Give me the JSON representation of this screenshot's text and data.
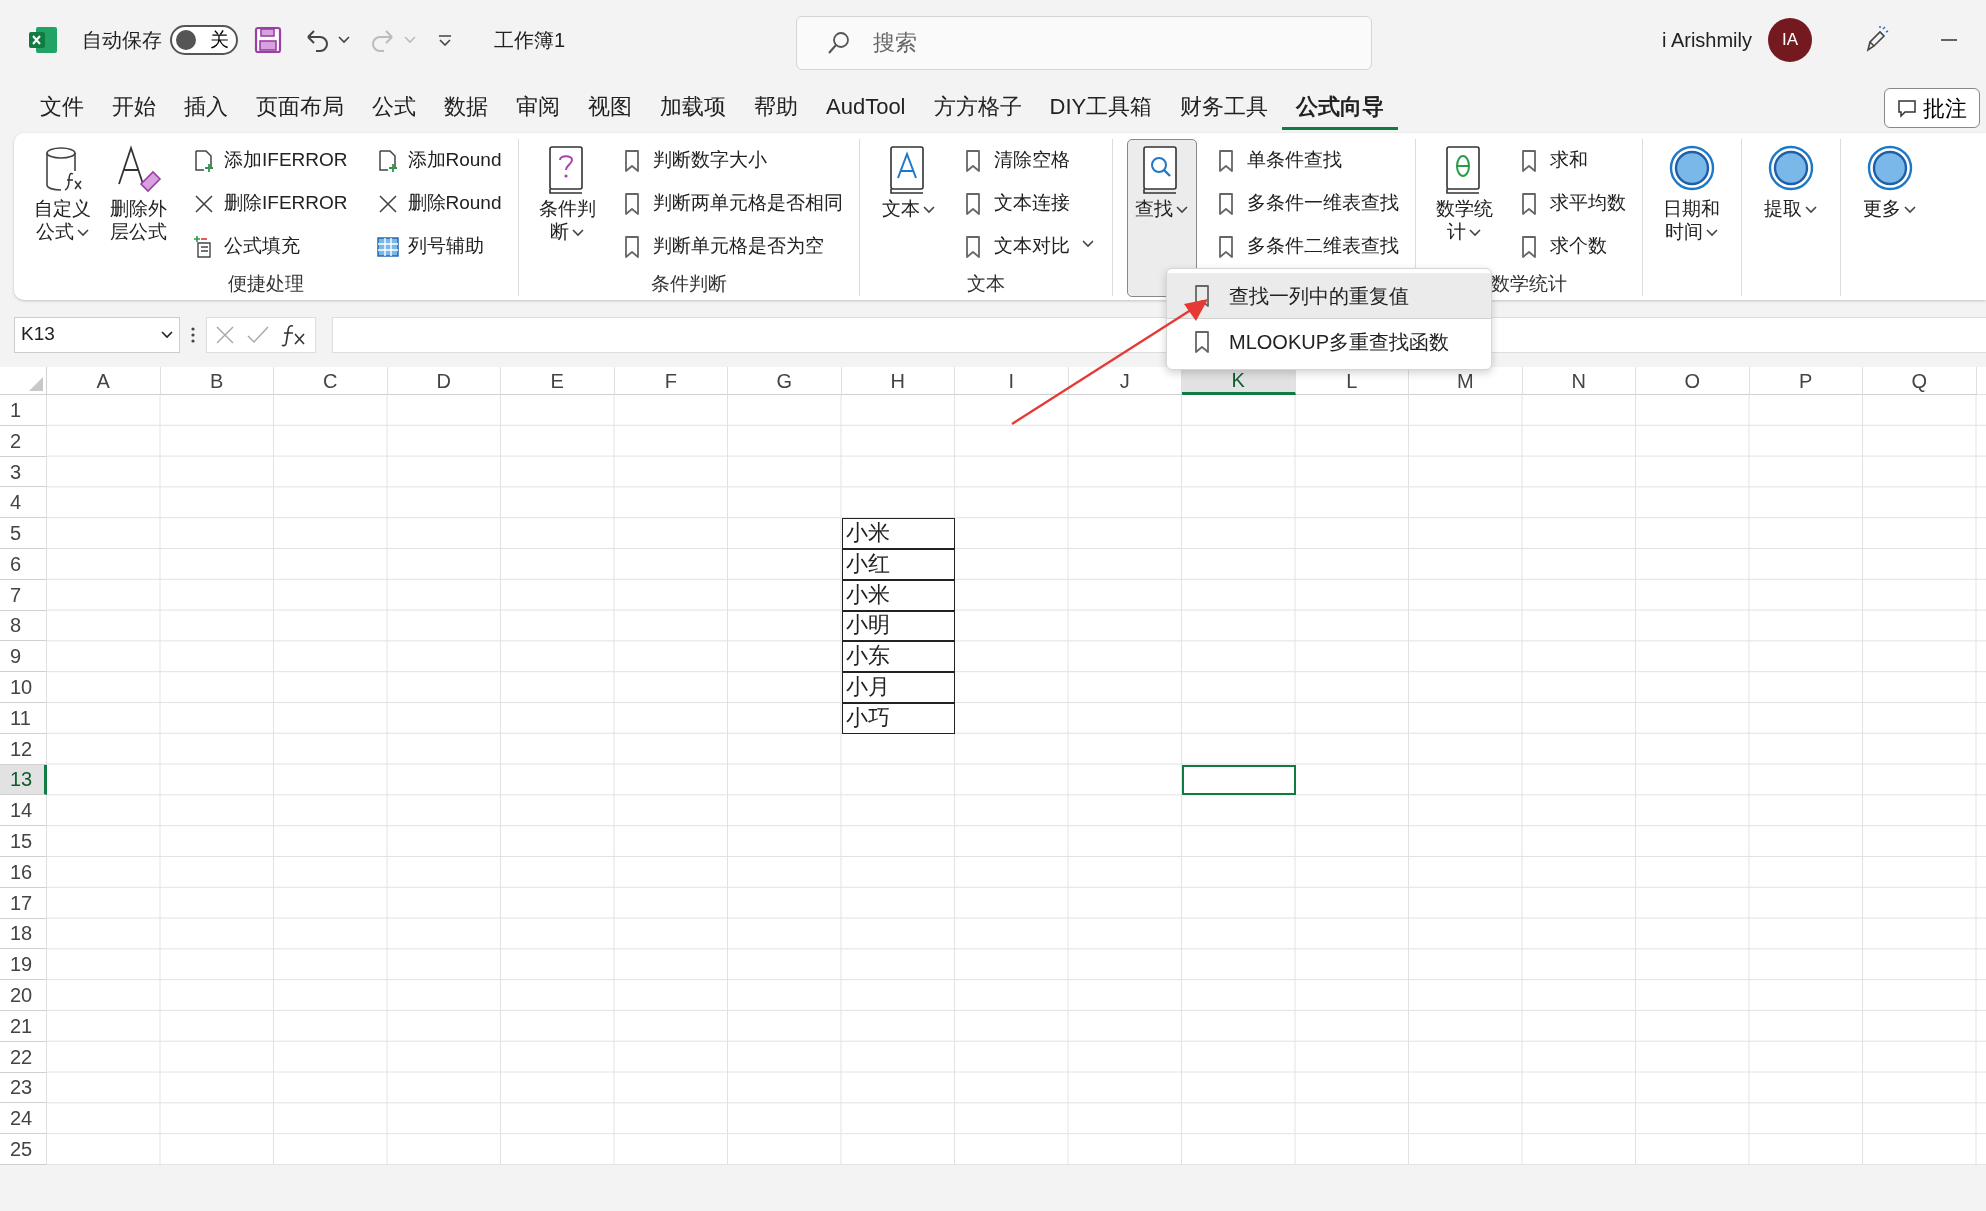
{
  "title_bar": {
    "autosave": {
      "label": "自动保存",
      "state_text": "关",
      "on": false
    },
    "workbook": "工作簿1",
    "search": {
      "placeholder": "搜索"
    },
    "user": "i Arishmily",
    "avatar": "IA"
  },
  "menu_tabs": [
    {
      "label": "文件",
      "selected": false
    },
    {
      "label": "开始",
      "selected": false
    },
    {
      "label": "插入",
      "selected": false
    },
    {
      "label": "页面布局",
      "selected": false
    },
    {
      "label": "公式",
      "selected": false
    },
    {
      "label": "数据",
      "selected": false
    },
    {
      "label": "审阅",
      "selected": false
    },
    {
      "label": "视图",
      "selected": false
    },
    {
      "label": "加载项",
      "selected": false
    },
    {
      "label": "帮助",
      "selected": false
    },
    {
      "label": "AudTool",
      "selected": false
    },
    {
      "label": "方方格子",
      "selected": false
    },
    {
      "label": "DIY工具箱",
      "selected": false
    },
    {
      "label": "财务工具",
      "selected": false
    },
    {
      "label": "公式向导",
      "selected": true
    }
  ],
  "comment_button": "批注",
  "ribbon_groups": [
    {
      "label": "便捷处理",
      "large": [
        {
          "label": "自定义公式",
          "menu": true,
          "expanded": false
        },
        {
          "label": "删除外层公式",
          "menu": false,
          "expanded": false
        }
      ],
      "items": [
        "添加IFERROR",
        "删除IFERROR",
        "公式填充",
        "添加Round",
        "删除Round",
        "列号辅助"
      ]
    },
    {
      "label": "条件判断",
      "large": [
        {
          "label": "条件判断",
          "menu": true,
          "expanded": false
        }
      ],
      "items": [
        "判断数字大小",
        "判断两单元格是否相同",
        "判断单元格是否为空"
      ]
    },
    {
      "label": "文本",
      "overflow_menu": true,
      "large": [
        {
          "label": "文本",
          "menu": true,
          "expanded": false
        }
      ],
      "items": [
        "清除空格",
        "文本连接",
        "文本对比"
      ]
    },
    {
      "large": [
        {
          "label": "查找",
          "menu": true,
          "expanded": true
        }
      ],
      "items": [
        "单条件查找",
        "多条件一维表查找",
        "多条件二维表查找"
      ]
    },
    {
      "label": "数学统计",
      "large": [
        {
          "label": "数学统计",
          "menu": true,
          "expanded": false
        }
      ],
      "items": [
        "求和",
        "求平均数",
        "求个数"
      ]
    },
    {
      "large": [
        {
          "label": "日期和时间",
          "menu": true,
          "expanded": false
        }
      ]
    },
    {
      "large": [
        {
          "label": "提取",
          "menu": true,
          "expanded": false
        }
      ]
    },
    {
      "large": [
        {
          "label": "更多",
          "menu": true,
          "expanded": false
        }
      ]
    }
  ],
  "dropdown": {
    "items": [
      {
        "label": "查找一列中的重复值",
        "selected": true
      },
      {
        "label": "MLOOKUP多重查找函数",
        "selected": false
      }
    ]
  },
  "formula_bar": {
    "name_box": "K13"
  },
  "sheet": {
    "columns": [
      {
        "label": "A",
        "highlighted": false
      },
      {
        "label": "B",
        "highlighted": false
      },
      {
        "label": "C",
        "highlighted": false
      },
      {
        "label": "D",
        "highlighted": false
      },
      {
        "label": "E",
        "highlighted": false
      },
      {
        "label": "F",
        "highlighted": false
      },
      {
        "label": "G",
        "highlighted": false
      },
      {
        "label": "H",
        "highlighted": false
      },
      {
        "label": "I",
        "highlighted": false
      },
      {
        "label": "J",
        "highlighted": false
      },
      {
        "label": "K",
        "highlighted": true
      },
      {
        "label": "L",
        "highlighted": false
      },
      {
        "label": "M",
        "highlighted": false
      },
      {
        "label": "N",
        "highlighted": false
      },
      {
        "label": "O",
        "highlighted": false
      },
      {
        "label": "P",
        "highlighted": false
      },
      {
        "label": "Q",
        "highlighted": false
      }
    ],
    "rows": [
      {
        "label": "1",
        "highlighted": false
      },
      {
        "label": "2",
        "highlighted": false
      },
      {
        "label": "3",
        "highlighted": false
      },
      {
        "label": "4",
        "highlighted": false
      },
      {
        "label": "5",
        "highlighted": false
      },
      {
        "label": "6",
        "highlighted": false
      },
      {
        "label": "7",
        "highlighted": false
      },
      {
        "label": "8",
        "highlighted": false
      },
      {
        "label": "9",
        "highlighted": false
      },
      {
        "label": "10",
        "highlighted": false
      },
      {
        "label": "11",
        "highlighted": false
      },
      {
        "label": "12",
        "highlighted": false
      },
      {
        "label": "13",
        "highlighted": true
      },
      {
        "label": "14",
        "highlighted": false
      },
      {
        "label": "15",
        "highlighted": false
      },
      {
        "label": "16",
        "highlighted": false
      },
      {
        "label": "17",
        "highlighted": false
      },
      {
        "label": "18",
        "highlighted": false
      },
      {
        "label": "19",
        "highlighted": false
      },
      {
        "label": "20",
        "highlighted": false
      },
      {
        "label": "21",
        "highlighted": false
      },
      {
        "label": "22",
        "highlighted": false
      },
      {
        "label": "23",
        "highlighted": false
      },
      {
        "label": "24",
        "highlighted": false
      },
      {
        "label": "25",
        "highlighted": false
      }
    ],
    "data_range": [
      {
        "text": "小米",
        "bordered": true
      },
      {
        "text": "小红",
        "bordered": true
      },
      {
        "text": "小米",
        "bordered": true
      },
      {
        "text": "小明",
        "bordered": true
      },
      {
        "text": "小东",
        "bordered": true
      },
      {
        "text": "小月",
        "bordered": true
      },
      {
        "text": "小巧",
        "bordered": true
      }
    ]
  }
}
